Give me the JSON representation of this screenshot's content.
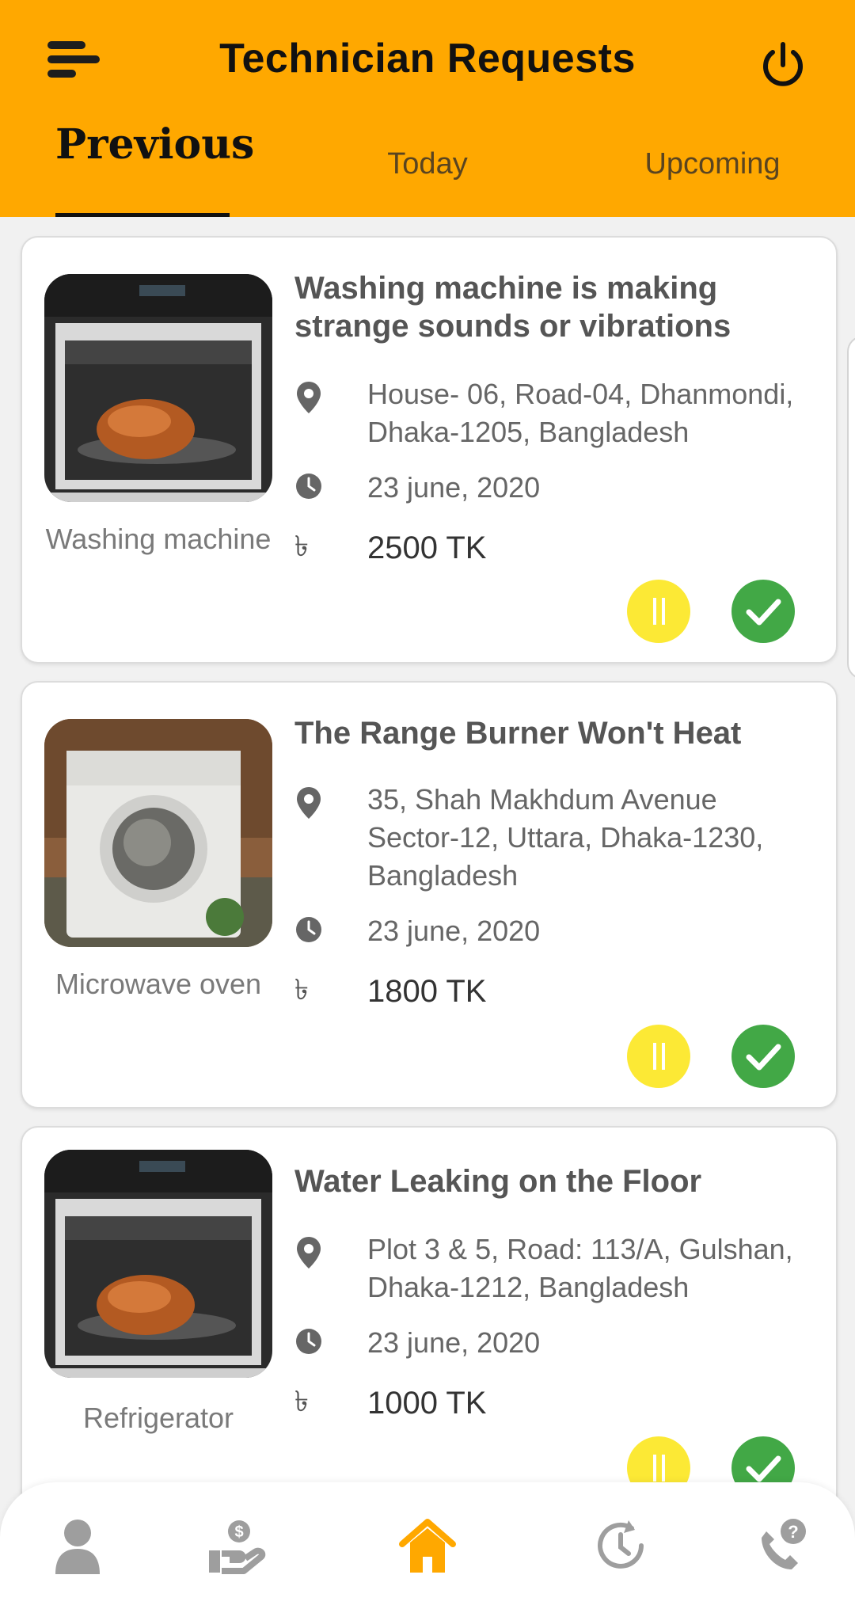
{
  "header": {
    "title": "Technician Requests",
    "background": "#ffa800"
  },
  "tabs": [
    {
      "label": "Previous",
      "active": true
    },
    {
      "label": "Today",
      "active": false
    },
    {
      "label": "Upcoming",
      "active": false
    }
  ],
  "requests": [
    {
      "title": "Washing machine is making strange sounds or vibrations",
      "category": "Washing machine",
      "image": "oven-photo",
      "address": "House- 06, Road-04, Dhanmondi, Dhaka-1205, Bangladesh",
      "date": "23 june, 2020",
      "price": "2500 TK"
    },
    {
      "title": "The Range Burner Won't Heat",
      "category": "Microwave oven",
      "image": "washing-machine-photo",
      "address": "35, Shah Makhdum Avenue Sector-12, Uttara, Dhaka-1230, Bangladesh",
      "date": "23 june, 2020",
      "price": "1800 TK"
    },
    {
      "title": "Water Leaking on the Floor",
      "category": "Refrigerator",
      "image": "oven-photo",
      "address": "Plot 3 & 5, Road: 113/A, Gulshan, Dhaka-1212, Bangladesh",
      "date": "23 june, 2020",
      "price": "1000 TK"
    }
  ],
  "colors": {
    "accent": "#ffa800",
    "pause": "#fce935",
    "accept": "#42a846"
  },
  "bottom_nav": [
    {
      "icon": "user-icon",
      "active": false
    },
    {
      "icon": "payment-hand-icon",
      "active": false
    },
    {
      "icon": "home-icon",
      "active": true
    },
    {
      "icon": "history-icon",
      "active": false
    },
    {
      "icon": "phone-help-icon",
      "active": false
    }
  ]
}
